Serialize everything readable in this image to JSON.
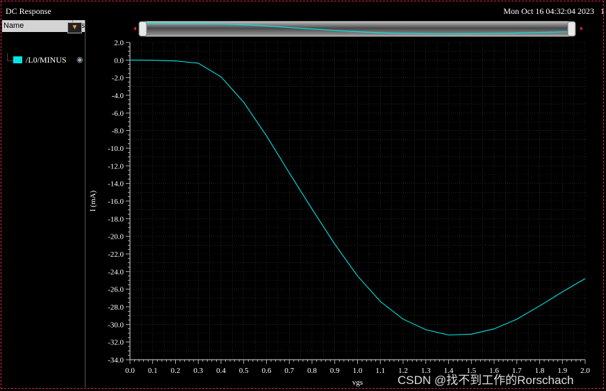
{
  "window": {
    "title": "DC Response",
    "timestamp": "Mon Oct 16 04:32:04 2023   1"
  },
  "legend": {
    "headers": {
      "name": "Name",
      "vis": "Vis"
    },
    "signals": [
      {
        "label": "/L0/MINUS",
        "color": "#00e5e5"
      }
    ]
  },
  "watermark": "CSDN @找不到工作的Rorschach",
  "colors": {
    "trace": "#00e5e5",
    "background": "#000000",
    "grid": "#3a3a3a"
  },
  "chart_data": {
    "type": "line",
    "xlabel": "vgs",
    "ylabel": "I (mA)",
    "xlim": [
      0.0,
      2.0
    ],
    "ylim": [
      -34.0,
      2.0
    ],
    "xticks": [
      "0.0",
      "0.1",
      "0.2",
      "0.3",
      "0.4",
      "0.5",
      "0.6",
      "0.7",
      "0.8",
      "0.9",
      "1.0",
      "1.1",
      "1.2",
      "1.3",
      "1.4",
      "1.5",
      "1.6",
      "1.7",
      "1.8",
      "1.9",
      "2.0"
    ],
    "yticks": [
      "2.0",
      "0.0",
      "-2.0",
      "-4.0",
      "-6.0",
      "-8.0",
      "-10.0",
      "-12.0",
      "-14.0",
      "-16.0",
      "-18.0",
      "-20.0",
      "-22.0",
      "-24.0",
      "-26.0",
      "-28.0",
      "-30.0",
      "-32.0",
      "-34.0"
    ],
    "grid": true,
    "series": [
      {
        "name": "/L0/MINUS",
        "x": [
          0.0,
          0.1,
          0.2,
          0.3,
          0.4,
          0.5,
          0.6,
          0.7,
          0.8,
          0.9,
          1.0,
          1.1,
          1.2,
          1.3,
          1.4,
          1.5,
          1.6,
          1.7,
          1.8,
          1.9,
          2.0
        ],
        "y": [
          0.0,
          -0.02,
          -0.1,
          -0.35,
          -1.9,
          -4.8,
          -8.6,
          -12.8,
          -16.9,
          -20.9,
          -24.5,
          -27.4,
          -29.4,
          -30.6,
          -31.2,
          -31.1,
          -30.5,
          -29.4,
          -27.9,
          -26.3,
          -24.8
        ]
      }
    ]
  }
}
